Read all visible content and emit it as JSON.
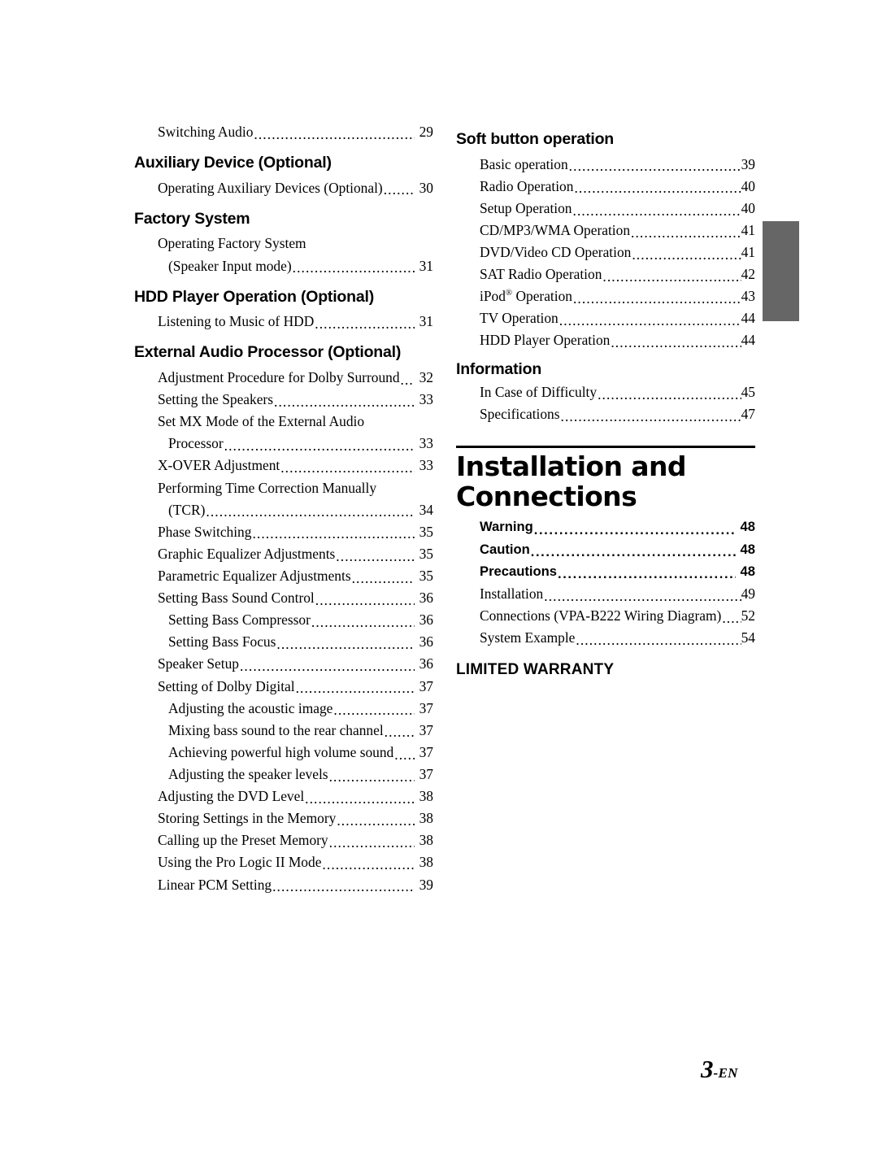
{
  "document": {
    "folio_number": "3",
    "folio_suffix": "-EN"
  },
  "left_column": {
    "orphan_entry": {
      "text": "Switching Audio",
      "page": "29"
    },
    "sections": [
      {
        "heading": "Auxiliary Device (Optional)",
        "entries": [
          {
            "text": "Operating Auxiliary Devices (Optional)",
            "page": "30",
            "level": 1
          }
        ]
      },
      {
        "heading": "Factory System",
        "entries": [
          {
            "text": "Operating Factory System",
            "page": "",
            "level": 1,
            "wrap_first": true
          },
          {
            "text": "(Speaker Input mode)",
            "page": "31",
            "level": 2
          }
        ]
      },
      {
        "heading": "HDD Player Operation (Optional)",
        "entries": [
          {
            "text": "Listening to Music of HDD",
            "page": "31",
            "level": 1
          }
        ]
      },
      {
        "heading": "External Audio Processor (Optional)",
        "entries": [
          {
            "text": "Adjustment Procedure for Dolby Surround",
            "page": "32",
            "level": 1
          },
          {
            "text": "Setting the Speakers",
            "page": "33",
            "level": 1
          },
          {
            "text": "Set MX Mode of the External Audio",
            "page": "",
            "level": 1,
            "wrap_first": true
          },
          {
            "text": "Processor",
            "page": "33",
            "level": 2
          },
          {
            "text": "X-OVER Adjustment",
            "page": "33",
            "level": 1
          },
          {
            "text": "Performing Time Correction Manually",
            "page": "",
            "level": 1,
            "wrap_first": true
          },
          {
            "text": "(TCR)",
            "page": "34",
            "level": 2
          },
          {
            "text": "Phase Switching",
            "page": "35",
            "level": 1
          },
          {
            "text": "Graphic Equalizer Adjustments",
            "page": "35",
            "level": 1
          },
          {
            "text": "Parametric Equalizer Adjustments",
            "page": "35",
            "level": 1
          },
          {
            "text": "Setting Bass Sound Control",
            "page": "36",
            "level": 1
          },
          {
            "text": "Setting Bass Compressor",
            "page": "36",
            "level": 2
          },
          {
            "text": "Setting Bass Focus",
            "page": "36",
            "level": 2
          },
          {
            "text": "Speaker Setup",
            "page": "36",
            "level": 1
          },
          {
            "text": "Setting of Dolby Digital",
            "page": "37",
            "level": 1
          },
          {
            "text": "Adjusting the acoustic image",
            "page": "37",
            "level": 2
          },
          {
            "text": "Mixing bass sound to the rear channel",
            "page": "37",
            "level": 2
          },
          {
            "text": "Achieving powerful high volume sound",
            "page": "37",
            "level": 2
          },
          {
            "text": "Adjusting the speaker levels",
            "page": "37",
            "level": 2
          },
          {
            "text": "Adjusting the DVD Level",
            "page": "38",
            "level": 1
          },
          {
            "text": "Storing Settings in the Memory",
            "page": "38",
            "level": 1
          },
          {
            "text": "Calling up the Preset Memory",
            "page": "38",
            "level": 1
          },
          {
            "text": "Using the Pro Logic II Mode",
            "page": "38",
            "level": 1
          },
          {
            "text": "Linear PCM Setting",
            "page": "39",
            "level": 1
          }
        ]
      }
    ]
  },
  "right_column": {
    "sections": [
      {
        "heading": "Soft button operation",
        "entries": [
          {
            "text": "Basic operation",
            "page": "39",
            "level": 1
          },
          {
            "text": "Radio Operation",
            "page": "40",
            "level": 1
          },
          {
            "text": "Setup Operation",
            "page": "40",
            "level": 1
          },
          {
            "text": "CD/MP3/WMA Operation",
            "page": "41",
            "level": 1
          },
          {
            "text": "DVD/Video CD Operation",
            "page": "41",
            "level": 1
          },
          {
            "text": "SAT Radio Operation",
            "page": "42",
            "level": 1
          },
          {
            "text": "iPod",
            "superscript": "®",
            "text_after": " Operation",
            "page": "43",
            "level": 1
          },
          {
            "text": "TV Operation",
            "page": "44",
            "level": 1
          },
          {
            "text": "HDD Player Operation",
            "page": "44",
            "level": 1
          }
        ]
      },
      {
        "heading": "Information",
        "entries": [
          {
            "text": "In Case of Difficulty",
            "page": "45",
            "level": 1
          },
          {
            "text": "Specifications",
            "page": "47",
            "level": 1
          }
        ]
      }
    ],
    "big_heading": {
      "line1": "Installation and",
      "line2": "Connections",
      "entries": [
        {
          "text": "Warning",
          "page": "48",
          "level": 1,
          "bold": true
        },
        {
          "text": "Caution",
          "page": "48",
          "level": 1,
          "bold": true
        },
        {
          "text": "Precautions",
          "page": "48",
          "level": 1,
          "bold": true
        },
        {
          "text": "Installation",
          "page": "49",
          "level": 1
        },
        {
          "text": "Connections (VPA-B222 Wiring Diagram)",
          "page": "52",
          "level": 1
        },
        {
          "text": "System Example",
          "page": "54",
          "level": 1
        }
      ]
    },
    "warranty_heading": "LIMITED WARRANTY"
  }
}
